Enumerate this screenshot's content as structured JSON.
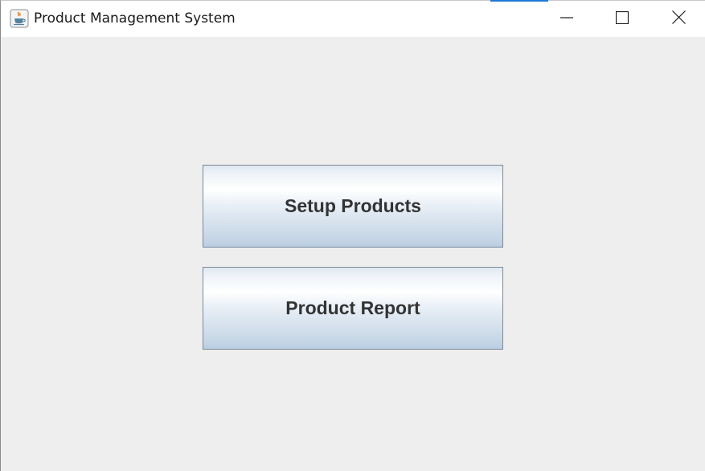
{
  "window": {
    "title": "Product Management System",
    "icon": "java-cup-icon",
    "controls": {
      "minimize": "minimize-icon",
      "maximize": "maximize-icon",
      "close": "close-icon"
    }
  },
  "main": {
    "buttons": [
      {
        "label": "Setup Products"
      },
      {
        "label": "Product Report"
      }
    ]
  },
  "colors": {
    "background": "#eeeeee",
    "titlebar": "#ffffff",
    "button_text": "#333333",
    "button_border": "#7a8a99",
    "accent": "#1e78d8"
  }
}
